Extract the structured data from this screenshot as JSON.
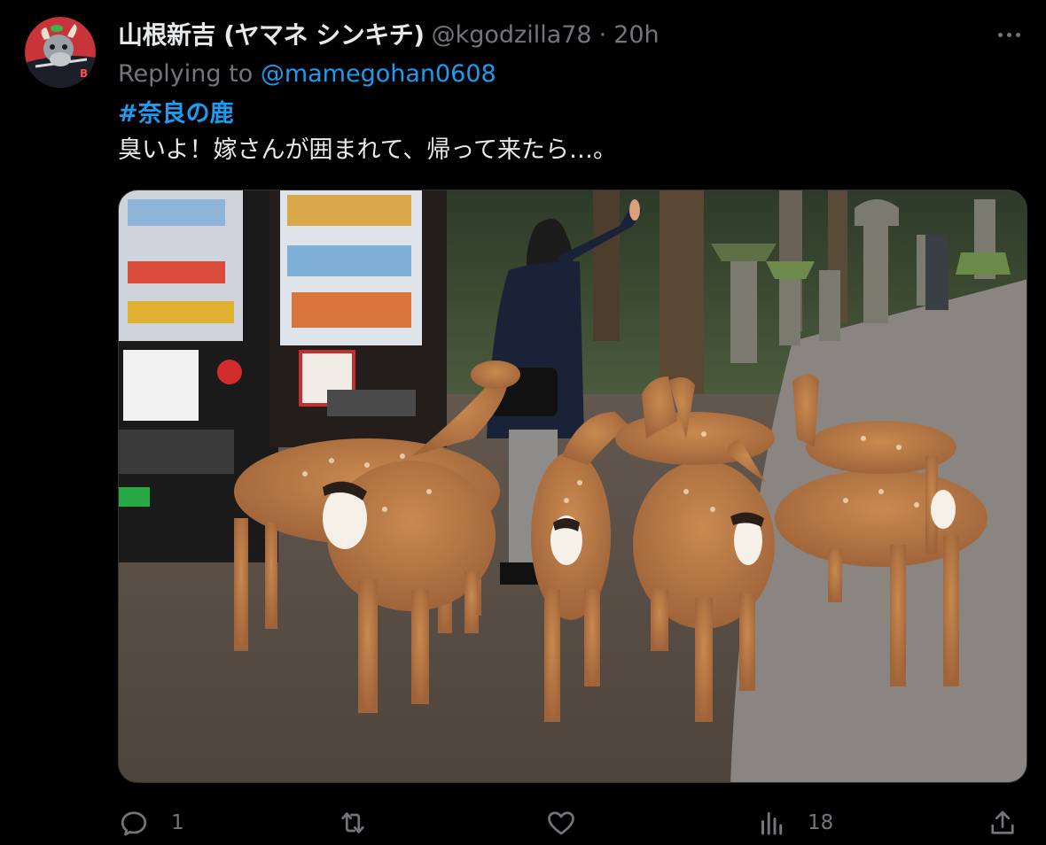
{
  "tweet": {
    "display_name": "山根新吉 (ヤマネ シンキチ)",
    "handle": "@kgodzilla78",
    "separator": "·",
    "time": "20h",
    "replying_prefix": "Replying to ",
    "replying_to": "@mamegohan0608",
    "hashtag": "#奈良の鹿",
    "text": "臭いよ！嫁さんが囲まれて、帰って来たら…。",
    "media_alt": "Person feeding a group of deer next to vending machines in Nara park"
  },
  "actions": {
    "reply_count": "1",
    "retweet_count": "",
    "like_count": "",
    "views_count": "18"
  },
  "icons": {
    "avatar": "avatar-image",
    "more": "more-icon",
    "reply": "reply-icon",
    "retweet": "retweet-icon",
    "like": "heart-icon",
    "views": "views-icon",
    "share": "share-icon"
  },
  "colors": {
    "background": "#000000",
    "text": "#e7e9ea",
    "muted": "#71767b",
    "link": "#1d9bf0",
    "border": "#2f3336"
  }
}
